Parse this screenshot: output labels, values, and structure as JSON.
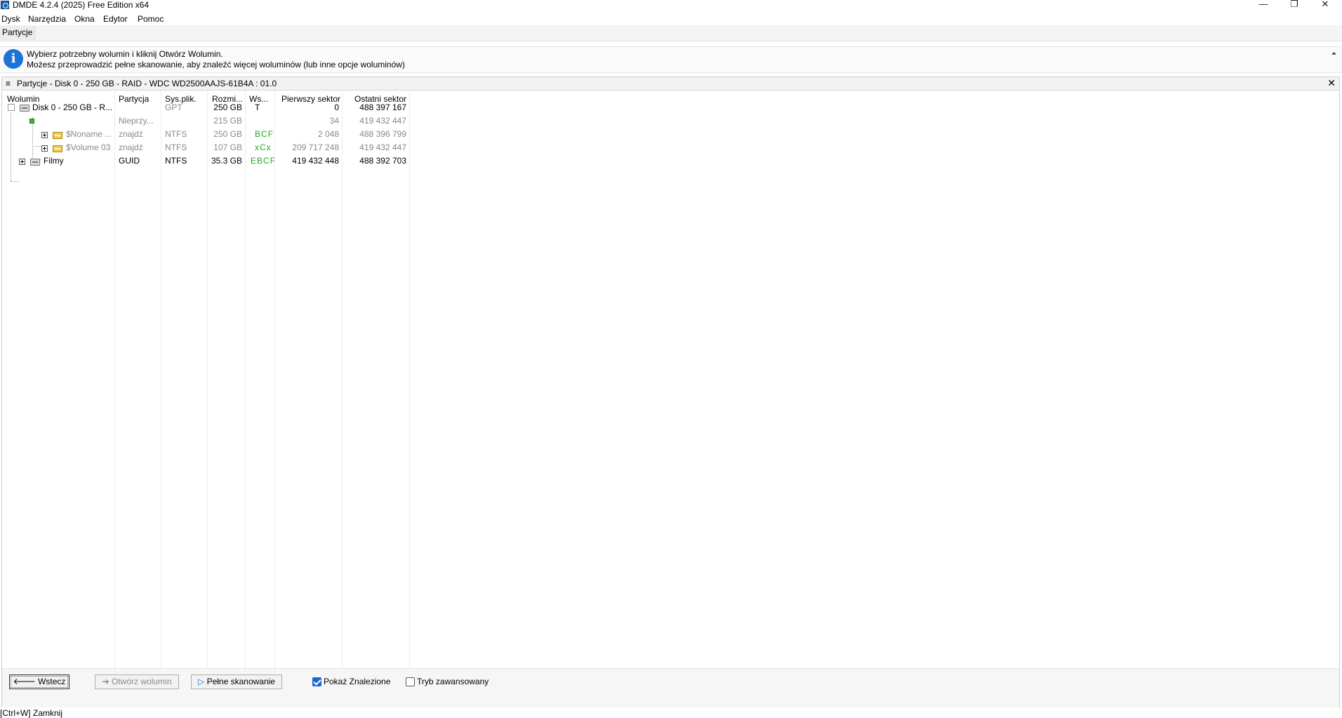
{
  "window": {
    "title": "DMDE 4.2.4 (2025) Free Edition x64",
    "minimize": "—",
    "restore": "❐",
    "close": "✕"
  },
  "menu": [
    "Dysk",
    "Narzędzia",
    "Okna",
    "Edytor",
    "Pomoc"
  ],
  "tab": {
    "label": "Partycje"
  },
  "info": {
    "line1": "Wybierz potrzebny wolumin i kliknij Otwórz Wolumin.",
    "line2": "Możesz przeprowadzić pełne skanowanie, aby znaleźć więcej woluminów (lub inne opcje woluminów)",
    "icon_glyph": "i",
    "collapse_glyph": "⏶"
  },
  "panel": {
    "title": "Partycje - Disk 0 - 250 GB - RAID - WDC WD2500AAJS-61B4A : 01.0",
    "menu_glyph": "≡",
    "close_glyph": "✕",
    "columns": [
      "Wolumin",
      "Partycja",
      "Sys.plik.",
      "Rozmi...",
      "Ws...",
      "Pierwszy sektor",
      "Ostatni sektor"
    ],
    "rows": [
      {
        "volume": "Disk 0 - 250 GB - R...",
        "partition": "",
        "fs": "GPT",
        "size": "250 GB",
        "flags": "T",
        "first": "0",
        "last": "488 397 167"
      },
      {
        "volume": "",
        "partition": "Nieprzy...",
        "fs": "",
        "size": "215 GB",
        "flags": "",
        "first": "34",
        "last": "419 432 447"
      },
      {
        "volume": "$Noname ...",
        "partition": "znajdź",
        "fs": "NTFS",
        "size": "250 GB",
        "flags": "BCF",
        "first": "2 048",
        "last": "488 396 799"
      },
      {
        "volume": "$Volume 03",
        "partition": "znajdź",
        "fs": "NTFS",
        "size": "107 GB",
        "flags": "xCx",
        "first": "209 717 248",
        "last": "419 432 447"
      },
      {
        "volume": "Filmy",
        "partition": "GUID",
        "fs": "NTFS",
        "size": "35.3 GB",
        "flags": "EBCF",
        "first": "419 432 448",
        "last": "488 392 703"
      }
    ]
  },
  "footer": {
    "back": "Wstecz",
    "back_glyph": "🡐",
    "open": "Otwórz wolumin",
    "open_glyph": "➔",
    "scan": "Pełne skanowanie",
    "scan_glyph": "▷",
    "show_found": "Pokaż Znalezione",
    "show_found_checked": true,
    "advanced": "Tryb zawansowany",
    "advanced_checked": false
  },
  "status": "[Ctrl+W] Zamknij",
  "colors": {
    "accent": "#1e73d8",
    "flag_green": "#22a82a",
    "muted": "#888888"
  }
}
